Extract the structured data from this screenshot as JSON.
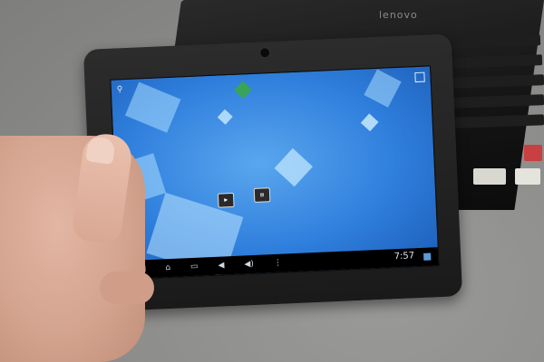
{
  "laptop": {
    "brand": "lenovo"
  },
  "tablet": {
    "status_time": "7:57",
    "apps": [
      {
        "icon": "video-app-icon",
        "label": ""
      },
      {
        "icon": "settings-app-icon",
        "label": ""
      }
    ],
    "nav": [
      {
        "icon": "back-icon",
        "glyph": "◁"
      },
      {
        "icon": "home-icon",
        "glyph": "⌂"
      },
      {
        "icon": "recents-icon",
        "glyph": "▭"
      },
      {
        "icon": "volume-down-icon",
        "glyph": "🔈"
      },
      {
        "icon": "volume-up-icon",
        "glyph": "🔊"
      },
      {
        "icon": "menu-icon",
        "glyph": "⋮"
      }
    ]
  },
  "colors": {
    "screen_blue": "#2f7fdd",
    "bezel": "#1a1a1a",
    "carpet": "#8e8e8c"
  }
}
